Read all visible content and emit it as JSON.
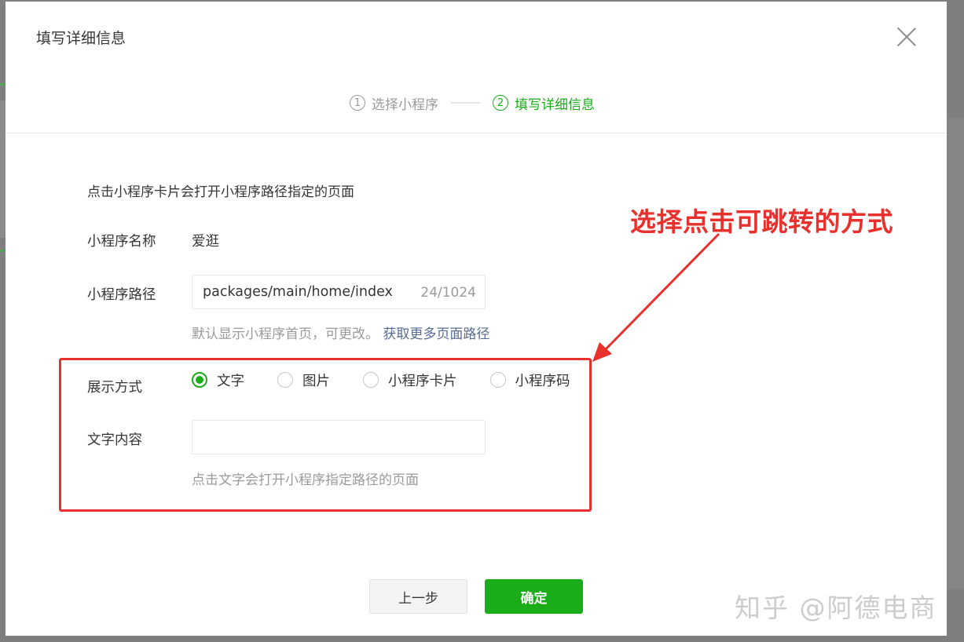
{
  "dialog": {
    "title": "填写详细信息",
    "close_icon": "close-icon"
  },
  "steps": [
    {
      "number": "1",
      "label": "选择小程序",
      "state": "inactive"
    },
    {
      "number": "2",
      "label": "填写详细信息",
      "state": "active"
    }
  ],
  "form": {
    "intro": "点击小程序卡片会打开小程序路径指定的页面",
    "name_label": "小程序名称",
    "name_value": "爱逛",
    "path_label": "小程序路径",
    "path_value": "packages/main/home/index",
    "path_counter": "24/1024",
    "path_hint": "默认显示小程序首页，可更改。",
    "path_link": "获取更多页面路径",
    "display_label": "展示方式",
    "display_options": [
      "文字",
      "图片",
      "小程序卡片",
      "小程序码"
    ],
    "display_selected": "文字",
    "text_label": "文字内容",
    "text_value": "",
    "text_hint": "点击文字会打开小程序指定路径的页面"
  },
  "buttons": {
    "prev": "上一步",
    "confirm": "确定"
  },
  "annotation": {
    "text": "选择点击可跳转的方式",
    "color": "#e8302d"
  },
  "watermark": "知乎 @阿德电商",
  "colors": {
    "accent": "#1aad19",
    "link": "#576b95"
  }
}
